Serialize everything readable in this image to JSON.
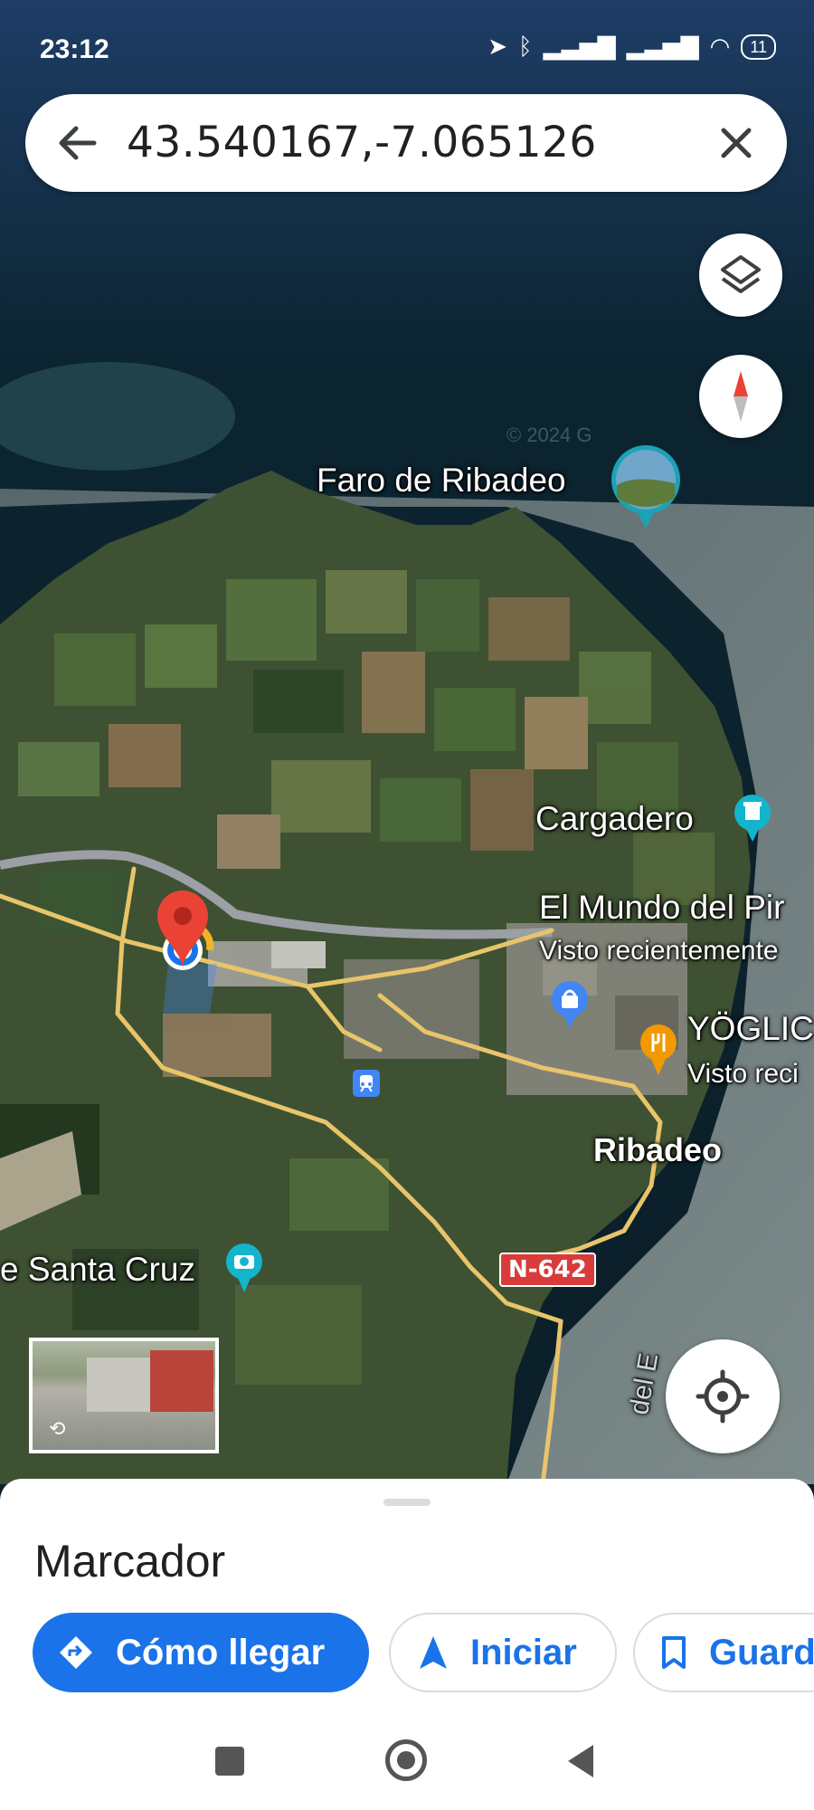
{
  "status_bar": {
    "time": "23:12",
    "battery": "11"
  },
  "search": {
    "query": "43.540167,-7.065126"
  },
  "map": {
    "labels": {
      "lighthouse": "Faro de Ribadeo",
      "cargadero": "Cargadero",
      "mundo": "El Mundo del Pir",
      "mundo_sub": "Visto recientemente",
      "yoglic": "YÖGLIC",
      "yoglic_sub": "Visto reci",
      "town": "Ribadeo",
      "santa_cruz": "e Santa Cruz",
      "road": "N-642",
      "shore": "del E"
    },
    "watermark": "© 2024 G"
  },
  "sheet": {
    "title": "Marcador",
    "buttons": {
      "directions": "Cómo llegar",
      "start": "Iniciar",
      "save": "Guard"
    }
  },
  "colors": {
    "accent": "#1a73e8",
    "pin": "#ea4335",
    "road": "#e8c46a",
    "rail": "#9aa0a6"
  },
  "icons": [
    "back-arrow-icon",
    "close-icon",
    "layers-icon",
    "compass-icon",
    "my-location-icon",
    "directions-icon",
    "navigation-icon",
    "bookmark-icon",
    "camera-icon",
    "restaurant-icon",
    "shopping-icon",
    "train-icon",
    "landmark-icon"
  ]
}
